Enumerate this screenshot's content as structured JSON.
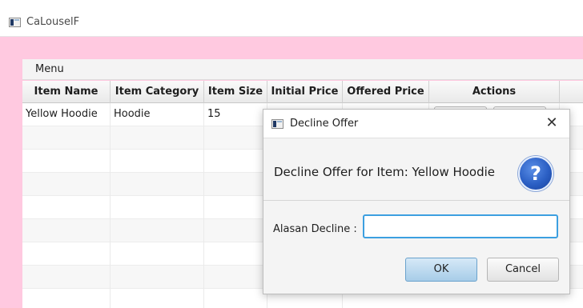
{
  "window": {
    "title": "CaLouselF"
  },
  "menubar": {
    "items": [
      "Menu"
    ]
  },
  "table": {
    "columns": [
      "Item Name",
      "Item Category",
      "Item Size",
      "Initial Price",
      "Offered Price",
      "Actions"
    ],
    "rows": [
      {
        "item_name": "Yellow Hoodie",
        "item_category": "Hoodie",
        "item_size": "15"
      }
    ]
  },
  "dialog": {
    "title": "Decline Offer",
    "header_text": "Decline Offer for Item: Yellow Hoodie",
    "question_glyph": "?",
    "field_label": "Alasan Decline :",
    "field_value": "",
    "field_placeholder": "",
    "ok_label": "OK",
    "cancel_label": "Cancel",
    "close_glyph": "✕"
  },
  "colors": {
    "background_pink": "#ffc9e0",
    "input_focus_border": "#3c9fe0",
    "ok_button": "#a7cde8",
    "question_icon": "#2b5fc4"
  }
}
